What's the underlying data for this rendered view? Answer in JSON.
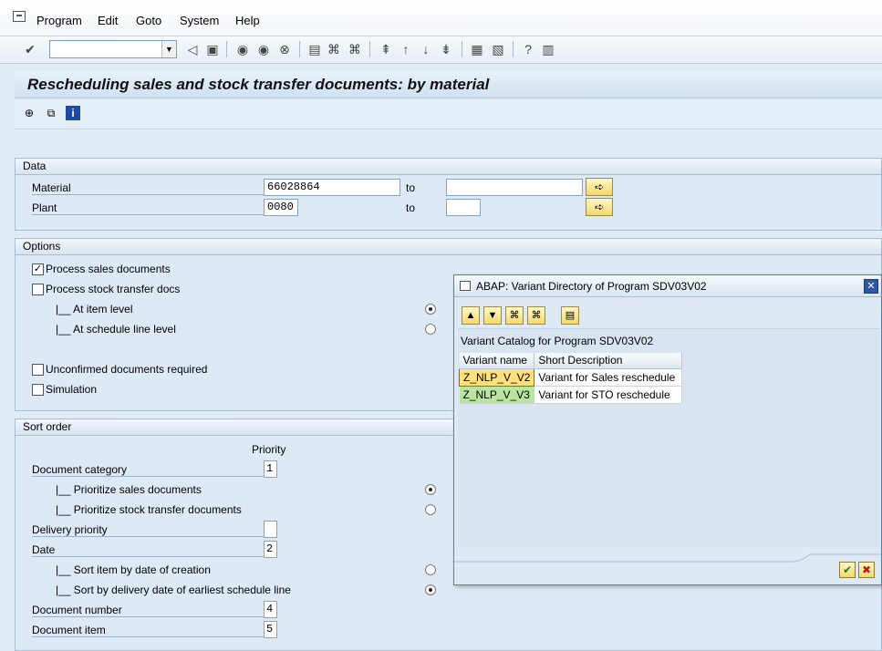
{
  "menu": [
    "Program",
    "Edit",
    "Goto",
    "System",
    "Help"
  ],
  "title": "Rescheduling sales and stock transfer documents: by material",
  "data_group": {
    "header": "Data",
    "material_label": "Material",
    "material_from": "66028864",
    "material_to": "",
    "plant_label": "Plant",
    "plant_from": "0080",
    "plant_to": "",
    "to_label": "to"
  },
  "options_group": {
    "header": "Options",
    "process_sales": "Process sales documents",
    "process_sales_checked": true,
    "process_sto": "Process stock transfer docs",
    "process_sto_checked": false,
    "at_item_level": "|__ At item level",
    "at_schedule_line": "|__ At schedule line level",
    "unconfirmed": "Unconfirmed documents required",
    "simulation": "Simulation"
  },
  "sort_group": {
    "header": "Sort order",
    "priority_label": "Priority",
    "doc_category": "Document category",
    "doc_category_val": "1",
    "prio_sales": "|__ Prioritize sales documents",
    "prio_sto": "|__ Prioritize stock transfer documents",
    "delivery_priority": "Delivery priority",
    "delivery_priority_val": "",
    "date": "Date",
    "date_val": "2",
    "sort_creation": "|__ Sort item by date of creation",
    "sort_delivery": "|__ Sort by delivery date of earliest schedule line",
    "doc_number": "Document number",
    "doc_number_val": "4",
    "doc_item": "Document item",
    "doc_item_val": "5"
  },
  "dialog": {
    "title": "ABAP: Variant Directory of Program SDV03V02",
    "catalog": "Variant Catalog for Program SDV03V02",
    "columns": [
      "Variant name",
      "Short Description"
    ],
    "rows": [
      {
        "name": "Z_NLP_V_V2",
        "desc": "Variant for Sales reschedule"
      },
      {
        "name": "Z_NLP_V_V3",
        "desc": "Variant for STO reschedule"
      }
    ]
  },
  "icons": {
    "close": "close-icon",
    "ok": "checkmark-icon",
    "cancel": "cross-icon"
  }
}
